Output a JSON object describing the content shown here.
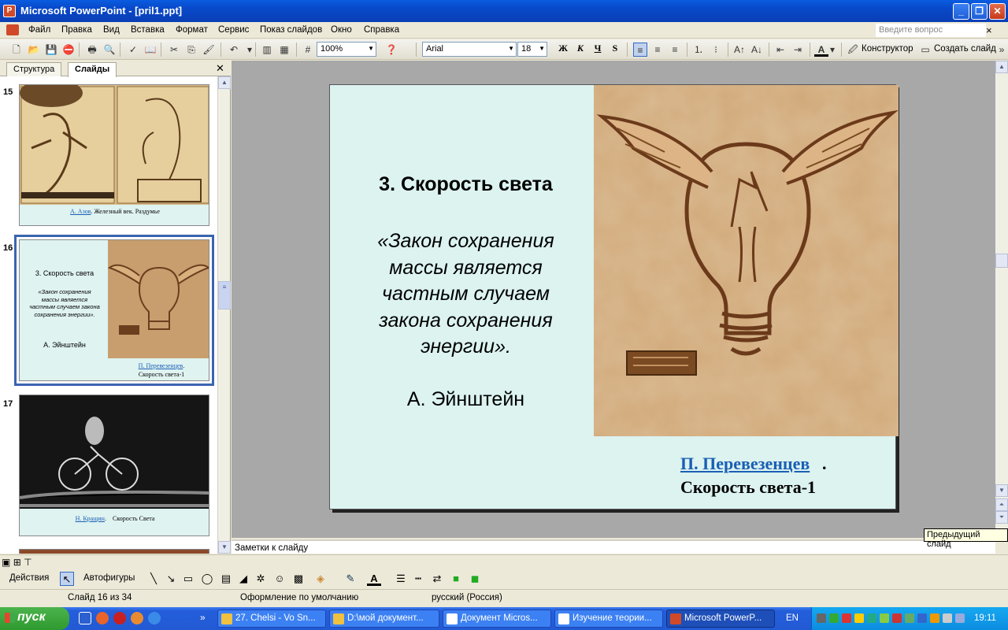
{
  "window": {
    "title": "Microsoft PowerPoint - [pril1.ppt]",
    "app_icon_letter": "P"
  },
  "menu": {
    "items": [
      "Файл",
      "Правка",
      "Вид",
      "Вставка",
      "Формат",
      "Сервис",
      "Показ слайдов",
      "Окно",
      "Справка"
    ],
    "ask_placeholder": "Введите вопрос"
  },
  "toolbar": {
    "zoom": "100%",
    "font": "Arial",
    "size": "18",
    "bold": "Ж",
    "italic": "К",
    "underline": "Ч",
    "shadow": "S",
    "design_label": "Конструктор",
    "new_slide_label": "Создать слайд"
  },
  "left_pane": {
    "tabs": [
      "Структура",
      "Слайды"
    ],
    "active_tab": "Слайды",
    "thumbnails": [
      {
        "number": "15",
        "caption_link": "А. Азов",
        "caption_rest": ". Железный век. Раздумье"
      },
      {
        "number": "16",
        "title": "3. Скорость света",
        "quote": "«Закон сохранения массы является частным случаем закона сохранения энергии».",
        "author": "А. Эйнштейн",
        "caption_link": "П. Перевезенцев",
        "caption_rest": "Скорость света-1"
      },
      {
        "number": "17",
        "caption_link": "Н. Кращин",
        "caption_rest": "Скорость Света"
      }
    ]
  },
  "slide": {
    "title": "3. Скорость света",
    "quote": "«Закон сохранения массы является частным случаем закона сохранения энергии».",
    "author": "А. Эйнштейн",
    "caption_link": "П. Перевезенцев",
    "caption_dot": ".",
    "caption_line2": "Скорость света-1"
  },
  "tooltip": "Предыдущий слайд",
  "notes_placeholder": "Заметки к слайду",
  "drawing": {
    "actions_label": "Действия",
    "autoshapes_label": "Автофигуры"
  },
  "status": {
    "slide_pos": "Слайд 16 из 34",
    "design": "Оформление по умолчанию",
    "language": "русский (Россия)"
  },
  "taskbar": {
    "start_label": "пуск",
    "tasks": [
      {
        "label": "27. Chelsi - Vo Sn...",
        "active": false
      },
      {
        "label": "D:\\мой документ...",
        "active": false
      },
      {
        "label": "Документ Micros...",
        "active": false
      },
      {
        "label": "Изучение теории...",
        "active": false
      },
      {
        "label": "Microsoft PowerP...",
        "active": true
      }
    ],
    "lang": "EN",
    "clock": "19:11"
  },
  "colors": {
    "slide_bg": "#dcf3f0",
    "link": "#1a5fb4",
    "selection_outline": "#3b64b0"
  }
}
